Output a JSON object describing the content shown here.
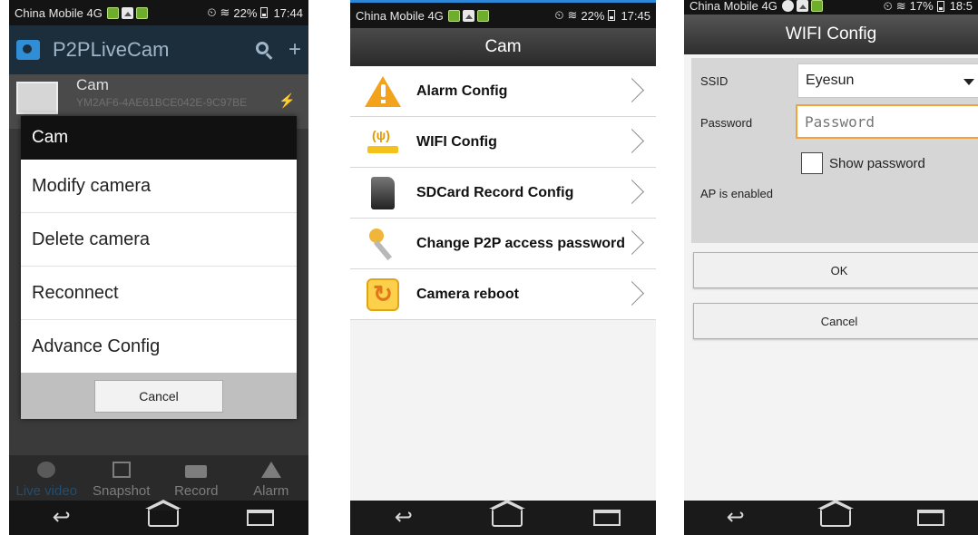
{
  "screen1": {
    "status": {
      "carrier": "China Mobile 4G",
      "battery": "22%",
      "time": "17:44"
    },
    "app_title": "P2PLiveCam",
    "camera": {
      "name": "Cam",
      "id": "YM2AF6-4AE61BCE042E-9C97BE"
    },
    "dialog": {
      "title": "Cam",
      "items": [
        "Modify camera",
        "Delete camera",
        "Reconnect",
        "Advance Config"
      ],
      "cancel": "Cancel"
    },
    "tabs": [
      "Live video",
      "Snapshot",
      "Record",
      "Alarm"
    ],
    "colors": {
      "appbar": "#1c2d3b",
      "active_tab": "#1f4f74"
    }
  },
  "screen2": {
    "status": {
      "carrier": "China Mobile 4G",
      "battery": "22%",
      "time": "17:45"
    },
    "title": "Cam",
    "menu": [
      {
        "label": "Alarm Config",
        "icon": "alarm-icon"
      },
      {
        "label": "WIFI Config",
        "icon": "wifi-icon"
      },
      {
        "label": "SDCard Record Config",
        "icon": "sdcard-icon"
      },
      {
        "label": "Change P2P access password",
        "icon": "key-icon"
      },
      {
        "label": "Camera reboot",
        "icon": "reboot-icon"
      }
    ]
  },
  "screen3": {
    "status": {
      "carrier": "China Mobile 4G",
      "battery": "17%",
      "time": "18:5"
    },
    "title": "WIFI Config",
    "ssid_label": "SSID",
    "ssid_value": "Eyesun",
    "password_label": "Password",
    "password_placeholder": "Password",
    "show_password": "Show password",
    "ap_status": "AP is enabled",
    "ok": "OK",
    "cancel": "Cancel"
  }
}
